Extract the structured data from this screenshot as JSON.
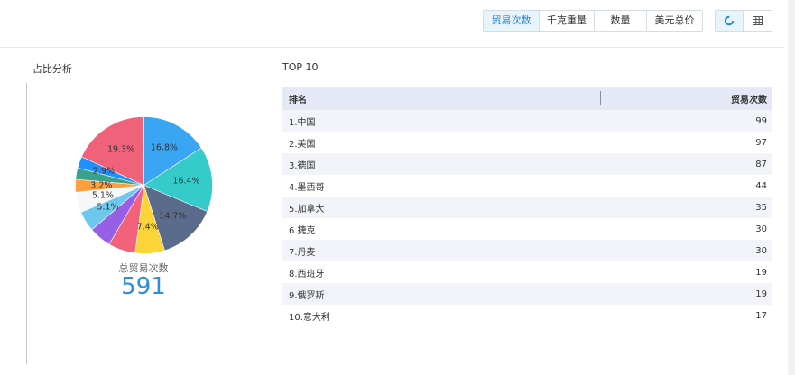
{
  "toolbar": {
    "metrics": [
      {
        "label": "贸易次数",
        "active": true
      },
      {
        "label": "千克重量",
        "active": false
      },
      {
        "label": "数量",
        "active": false
      },
      {
        "label": "美元总价",
        "active": false
      }
    ],
    "views": [
      {
        "icon": "pie-chart-icon",
        "active": true
      },
      {
        "icon": "table-icon",
        "active": false
      }
    ]
  },
  "left": {
    "title": "占比分析",
    "total_label": "总贸易次数",
    "total_value": "591"
  },
  "chart_data": {
    "type": "pie",
    "slices": [
      {
        "label": "16.8%",
        "value": 16.8,
        "color": "#3aa6f3"
      },
      {
        "label": "16.4%",
        "value": 16.4,
        "color": "#36cbcb"
      },
      {
        "label": "14.7%",
        "value": 14.7,
        "color": "#5b6b8c"
      },
      {
        "label": "7.4%",
        "value": 7.4,
        "color": "#fbd437"
      },
      {
        "label": "",
        "value": 6.8,
        "color": "#f2637b"
      },
      {
        "label": "",
        "value": 5.6,
        "color": "#975fe5"
      },
      {
        "label": "5.1%",
        "value": 5.1,
        "color": "#6ec8ee"
      },
      {
        "label": "5.1%",
        "value": 5.1,
        "color": "#f7f7f7"
      },
      {
        "label": "3.2%",
        "value": 3.2,
        "color": "#ff9f40"
      },
      {
        "label": "",
        "value": 2.9,
        "color": "#3aa18f"
      },
      {
        "label": "2.9%",
        "value": 2.9,
        "color": "#1e90ff"
      },
      {
        "label": "19.3%",
        "value": 19.3,
        "color": "#f0627a"
      }
    ]
  },
  "right": {
    "title": "TOP 10",
    "headers": [
      "排名",
      "贸易次数"
    ],
    "rows": [
      {
        "name": "1.中国",
        "value": "99"
      },
      {
        "name": "2.美国",
        "value": "97"
      },
      {
        "name": "3.德国",
        "value": "87"
      },
      {
        "name": "4.墨西哥",
        "value": "44"
      },
      {
        "name": "5.加拿大",
        "value": "35"
      },
      {
        "name": "6.捷克",
        "value": "30"
      },
      {
        "name": "7.丹麦",
        "value": "30"
      },
      {
        "name": "8.西班牙",
        "value": "19"
      },
      {
        "name": "9.俄罗斯",
        "value": "19"
      },
      {
        "name": "10.意大利",
        "value": "17"
      }
    ]
  }
}
